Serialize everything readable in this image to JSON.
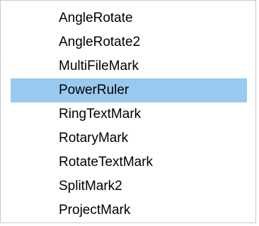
{
  "menu": {
    "selected_index": 3,
    "highlight_color": "#99c9ef",
    "items": [
      {
        "label": "AngleRotate"
      },
      {
        "label": "AngleRotate2"
      },
      {
        "label": "MultiFileMark"
      },
      {
        "label": "PowerRuler"
      },
      {
        "label": "RingTextMark"
      },
      {
        "label": "RotaryMark"
      },
      {
        "label": "RotateTextMark"
      },
      {
        "label": "SplitMark2"
      },
      {
        "label": "ProjectMark"
      }
    ]
  }
}
